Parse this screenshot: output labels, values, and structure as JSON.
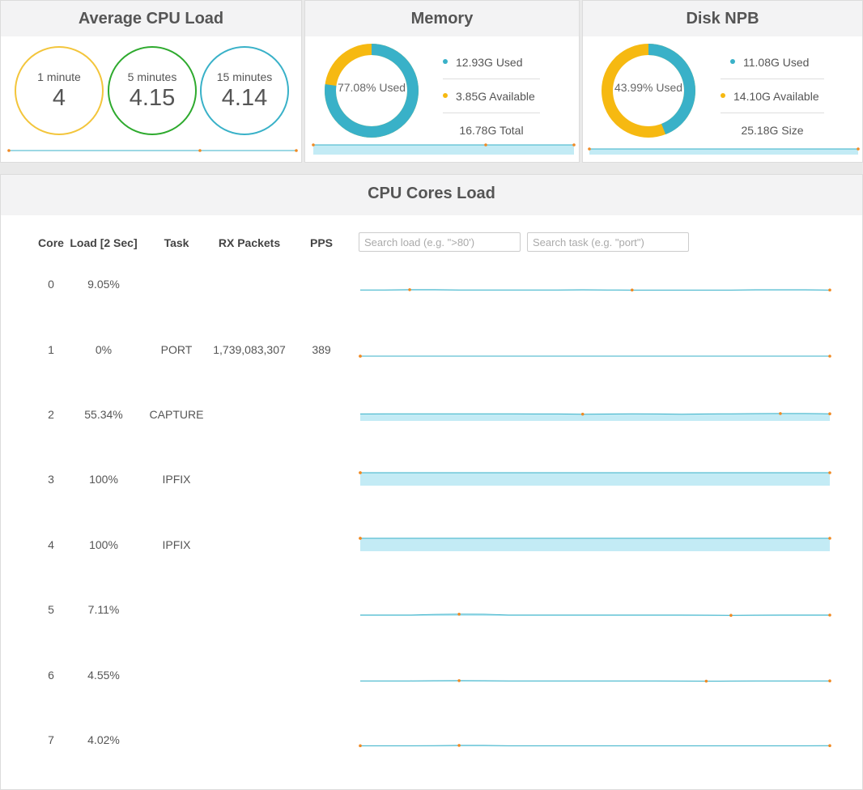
{
  "colors": {
    "accent": "#39b1c8",
    "secondary": "#f6b911",
    "green": "#2eaa2e",
    "marker": "#f08a24",
    "fill": "#c3ebf5"
  },
  "cpu": {
    "title": "Average CPU Load",
    "rings": [
      {
        "label": "1 minute",
        "value": "4",
        "color": "#f3c53b"
      },
      {
        "label": "5 minutes",
        "value": "4.15",
        "color": "#2eaa2e"
      },
      {
        "label": "15 minutes",
        "value": "4.14",
        "color": "#39b1c8"
      }
    ]
  },
  "memory": {
    "title": "Memory",
    "used_pct": 77.08,
    "center_label": "77.08% Used",
    "used": "12.93G Used",
    "available": "3.85G Available",
    "total": "16.78G Total"
  },
  "disk": {
    "title": "Disk NPB",
    "used_pct": 43.99,
    "center_label": "43.99% Used",
    "used": "11.08G Used",
    "available": "14.10G Available",
    "size": "25.18G Size"
  },
  "cores": {
    "title": "CPU Cores Load",
    "headers": {
      "core": "Core",
      "load": "Load [2 Sec]",
      "task": "Task",
      "rx": "RX Packets",
      "pps": "PPS"
    },
    "search_load_placeholder": "Search load (e.g. \">80')",
    "search_task_placeholder": "Search task (e.g. \"port\")",
    "rows": [
      {
        "core": "0",
        "load": "9.05%",
        "task": "",
        "rx": "",
        "pps": "",
        "history": [
          5,
          5,
          7,
          7,
          5,
          5,
          5,
          5,
          5,
          6,
          5,
          4,
          4,
          4,
          4,
          4,
          6,
          6,
          6,
          4
        ]
      },
      {
        "core": "1",
        "load": "0%",
        "task": "PORT",
        "rx": "1,739,083,307",
        "pps": "389",
        "history": [
          0,
          0,
          0,
          0,
          0,
          0,
          0,
          0,
          0,
          0,
          0,
          0,
          0,
          0,
          0,
          0,
          0,
          0,
          0,
          0
        ]
      },
      {
        "core": "2",
        "load": "55.34%",
        "task": "CAPTURE",
        "rx": "",
        "pps": "",
        "history": [
          54,
          55,
          55,
          55,
          55,
          55,
          55,
          54,
          54,
          52,
          53,
          55,
          54,
          52,
          54,
          55,
          56,
          57,
          57,
          55
        ]
      },
      {
        "core": "3",
        "load": "100%",
        "task": "IPFIX",
        "rx": "",
        "pps": "",
        "history": [
          100,
          100,
          100,
          100,
          100,
          100,
          100,
          100,
          100,
          100,
          100,
          100,
          100,
          100,
          100,
          100,
          100,
          100,
          100,
          100
        ]
      },
      {
        "core": "4",
        "load": "100%",
        "task": "IPFIX",
        "rx": "",
        "pps": "",
        "history": [
          100,
          100,
          100,
          100,
          100,
          100,
          100,
          100,
          100,
          100,
          100,
          100,
          100,
          100,
          100,
          100,
          100,
          100,
          100,
          100
        ]
      },
      {
        "core": "5",
        "load": "7.11%",
        "task": "",
        "rx": "",
        "pps": "",
        "history": [
          7,
          7,
          7,
          12,
          14,
          13,
          7,
          7,
          7,
          7,
          7,
          7,
          7,
          7,
          6,
          5,
          6,
          7,
          7,
          7
        ]
      },
      {
        "core": "6",
        "load": "4.55%",
        "task": "",
        "rx": "",
        "pps": "",
        "history": [
          5,
          5,
          5,
          6,
          7,
          6,
          5,
          5,
          5,
          5,
          5,
          5,
          5,
          4,
          3,
          4,
          5,
          5,
          5,
          5
        ]
      },
      {
        "core": "7",
        "load": "4.02%",
        "task": "",
        "rx": "",
        "pps": "",
        "history": [
          4,
          4,
          4,
          5,
          7,
          7,
          4,
          4,
          4,
          4,
          4,
          4,
          4,
          4,
          4,
          4,
          4,
          4,
          4,
          5
        ]
      }
    ]
  }
}
